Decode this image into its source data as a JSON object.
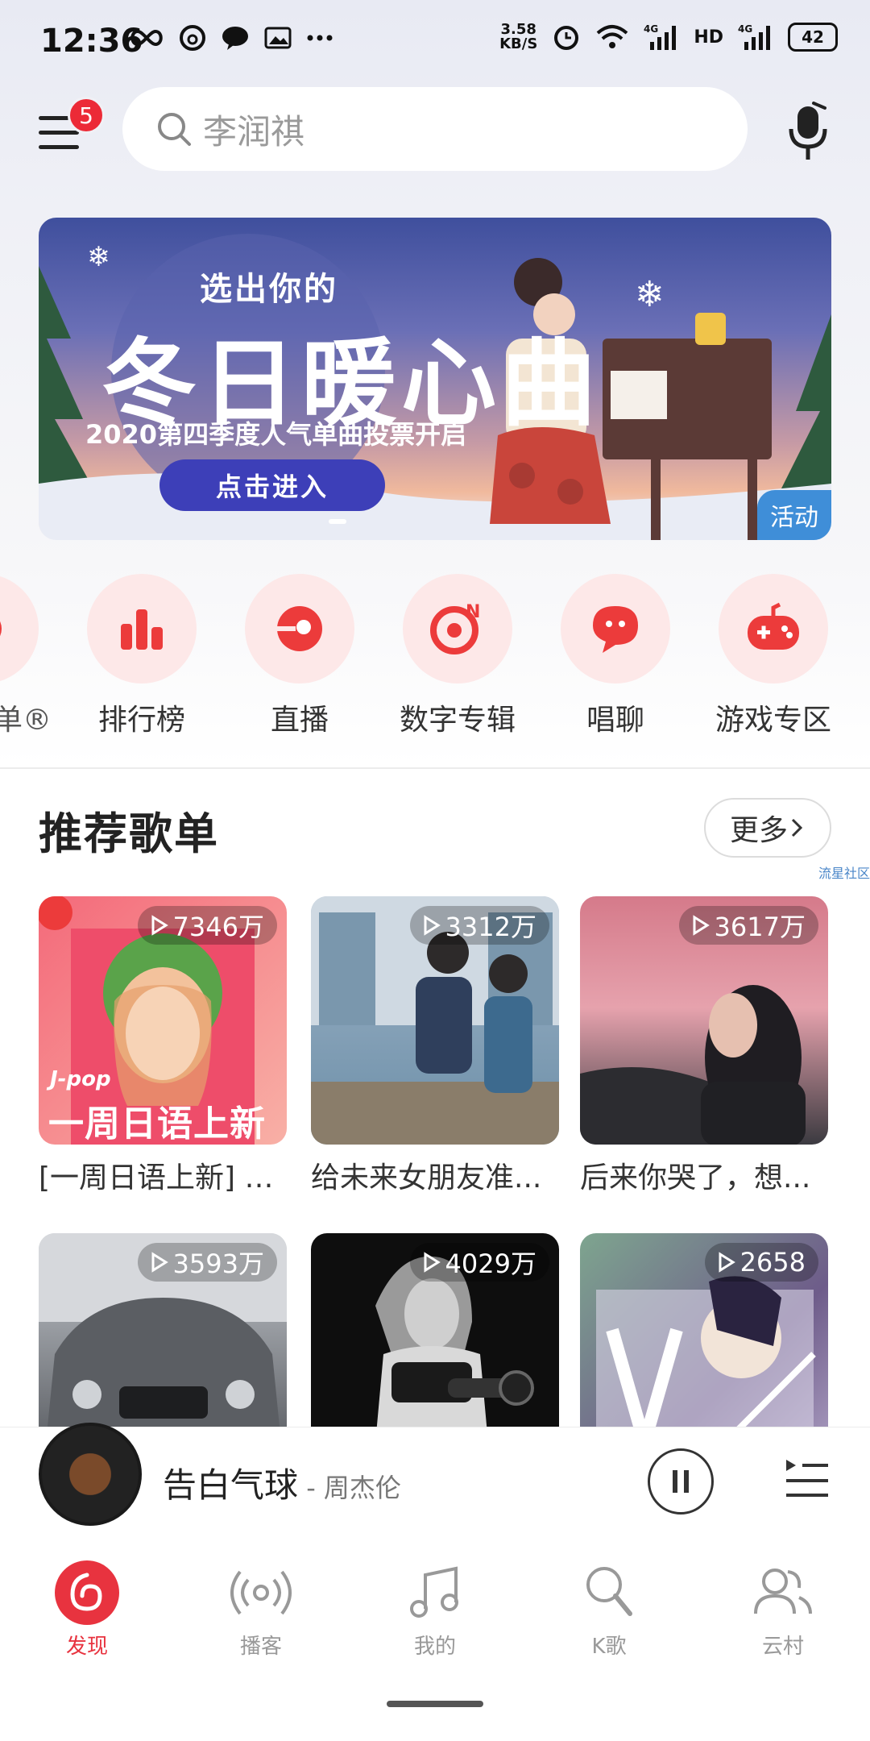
{
  "status_bar": {
    "time": "12:36",
    "net_speed_value": "3.58",
    "net_speed_unit": "KB/S",
    "signal_1": "4G",
    "hd": "HD",
    "signal_2": "4G",
    "battery": "42"
  },
  "header": {
    "menu_badge": "5",
    "search_placeholder": "李润祺"
  },
  "banner": {
    "subtitle": "选出你的",
    "title": "冬日暖心曲",
    "caption": "2020第四季度人气单曲投票开启",
    "cta": "点击进入",
    "tag": "活动"
  },
  "categories": [
    {
      "label": "单®",
      "icon": "partial-icon"
    },
    {
      "label": "排行榜",
      "icon": "chart-bars-icon"
    },
    {
      "label": "直播",
      "icon": "live-icon"
    },
    {
      "label": "数字专辑",
      "icon": "digital-album-icon"
    },
    {
      "label": "唱聊",
      "icon": "chat-sing-icon"
    },
    {
      "label": "游戏专区",
      "icon": "gamepad-icon"
    }
  ],
  "recommended": {
    "title": "推荐歌单",
    "more": "更多",
    "watermark": "流星社区",
    "playlists": [
      {
        "plays": "7346万",
        "title": "[一周日语上新] 冬...",
        "cover_text": "一周日语上新",
        "cover_tag": "J-pop"
      },
      {
        "plays": "3312万",
        "title": "给未来女朋友准..."
      },
      {
        "plays": "3617万",
        "title": "后来你哭了，想..."
      },
      {
        "plays": "3593万",
        "title": ""
      },
      {
        "plays": "4029万",
        "title": ""
      },
      {
        "plays": "2658",
        "title": ""
      }
    ]
  },
  "player": {
    "song": "告白气球",
    "artist": " - 周杰伦"
  },
  "tabs": [
    {
      "label": "发现",
      "active": true
    },
    {
      "label": "播客",
      "active": false
    },
    {
      "label": "我的",
      "active": false
    },
    {
      "label": "K歌",
      "active": false
    },
    {
      "label": "云村",
      "active": false
    }
  ],
  "colors": {
    "accent": "#e8333f",
    "banner_button": "#3d3fb8",
    "tag_blue": "#3f8ed8"
  }
}
